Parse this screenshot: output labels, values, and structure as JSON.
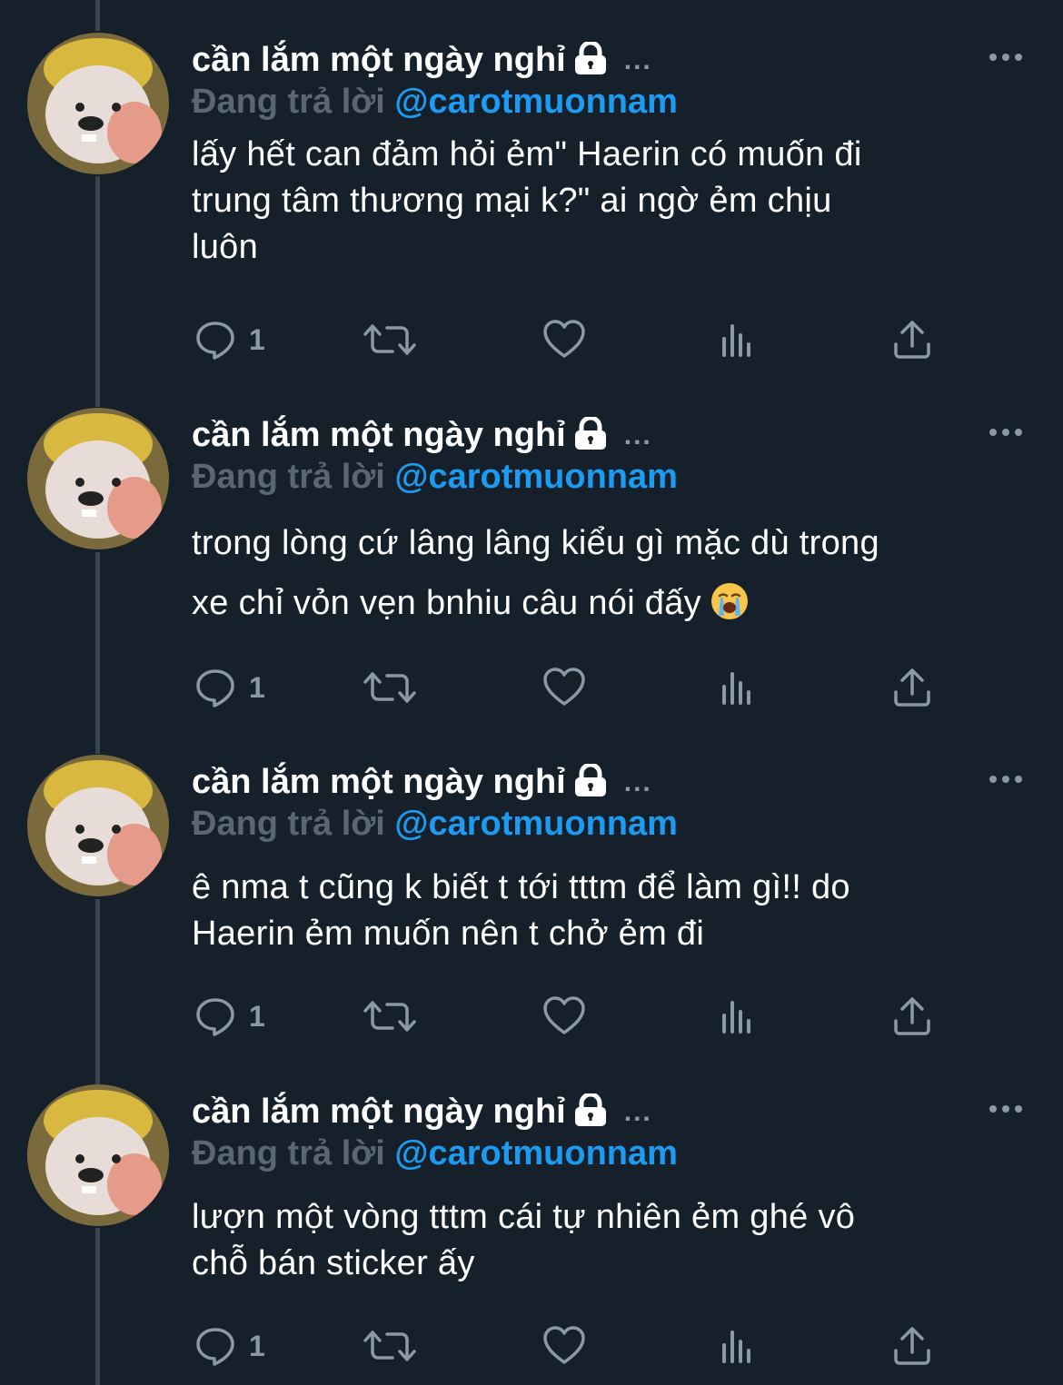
{
  "tweets": [
    {
      "display_name": "cần lắm một ngày nghỉ",
      "more_dots": "...",
      "reply_prefix": "Đang trả lời",
      "reply_handle": "@carotmuonnam",
      "lines": [
        "lấy hết can đảm hỏi ẻm\" Haerin có muốn đi",
        "trung tâm thương mại k?\" ai ngờ ẻm chịu",
        "luôn"
      ],
      "reply_count": "1"
    },
    {
      "display_name": "cần lắm một ngày nghỉ",
      "more_dots": "...",
      "reply_prefix": "Đang trả lời",
      "reply_handle": "@carotmuonnam",
      "lines": [
        "trong lòng cứ lâng lâng kiểu gì mặc dù trong",
        "xe chỉ vỏn vẹn bnhiu câu nói đấy"
      ],
      "emoji": "loudly-crying-face",
      "reply_count": "1"
    },
    {
      "display_name": "cần lắm một ngày nghỉ",
      "more_dots": "...",
      "reply_prefix": "Đang trả lời",
      "reply_handle": "@carotmuonnam",
      "lines": [
        "ê nma t cũng k biết t tới tttm để làm gì!! do",
        "Haerin ẻm muốn nên t chở ẻm đi"
      ],
      "reply_count": "1"
    },
    {
      "display_name": "cần lắm một ngày nghỉ",
      "more_dots": "...",
      "reply_prefix": "Đang trả lời",
      "reply_handle": "@carotmuonnam",
      "lines": [
        "lượn một vòng tttm cái tự nhiên ẻm ghé vô",
        "chỗ bán sticker ấy"
      ],
      "reply_count": "1"
    }
  ],
  "icons": [
    "reply-icon",
    "retweet-icon",
    "like-icon",
    "views-icon",
    "share-icon",
    "lock-icon",
    "more-options-icon"
  ],
  "colors": {
    "background": "#15202b",
    "text": "#ffffff",
    "muted": "#8b98a5",
    "reply_prefix": "#5b6770",
    "link": "#1d9bf0",
    "thread_line": "#38444d"
  }
}
